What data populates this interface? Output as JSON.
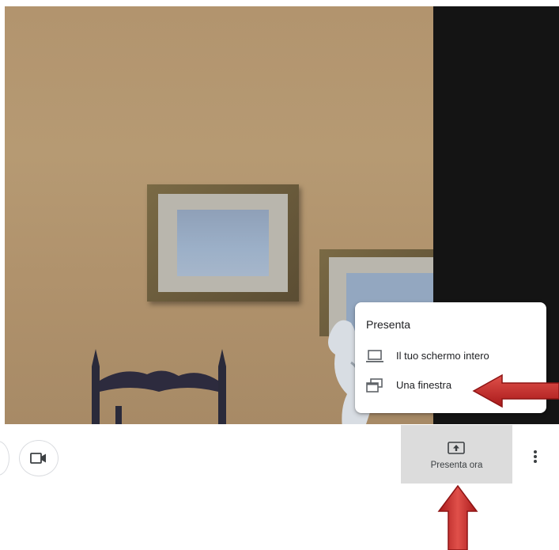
{
  "menu": {
    "title": "Presenta",
    "items": [
      {
        "label": "Il tuo schermo intero",
        "icon": "laptop-icon"
      },
      {
        "label": "Una finestra",
        "icon": "window-icon"
      }
    ]
  },
  "toolbar": {
    "present_label": "Presenta ora",
    "camera_icon": "videocam-icon",
    "present_icon": "present-screen-icon",
    "more_icon": "more-vert-icon"
  },
  "colors": {
    "annotation_arrow": "#c0211f",
    "present_button_bg": "#dcdcdc"
  }
}
